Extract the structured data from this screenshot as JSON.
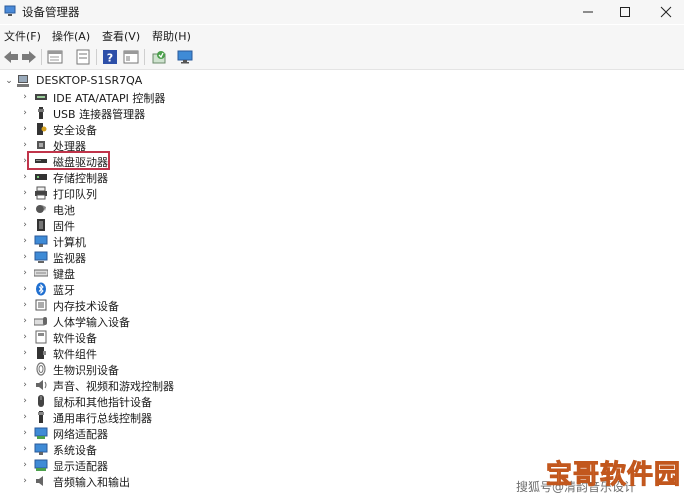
{
  "window": {
    "title": "设备管理器",
    "minimize_icon": "minimize-icon",
    "maximize_icon": "maximize-icon",
    "close_icon": "close-icon"
  },
  "menu": [
    {
      "label": "文件(F)"
    },
    {
      "label": "操作(A)"
    },
    {
      "label": "查看(V)"
    },
    {
      "label": "帮助(H)"
    }
  ],
  "toolbar": {
    "buttons": [
      "back-arrow-icon",
      "forward-arrow-icon",
      "properties-icon",
      "update-driver-icon",
      "help-icon",
      "view-icon",
      "scan-hardware-icon",
      "monitor-icon"
    ]
  },
  "tree": {
    "root": "DESKTOP-S1SR7QA",
    "nodes": [
      {
        "label": "IDE ATA/ATAPI 控制器",
        "icon": "ide-controller-icon"
      },
      {
        "label": "USB 连接器管理器",
        "icon": "usb-icon"
      },
      {
        "label": "安全设备",
        "icon": "security-device-icon"
      },
      {
        "label": "处理器",
        "icon": "processor-icon"
      },
      {
        "label": "磁盘驱动器",
        "icon": "disk-drive-icon"
      },
      {
        "label": "存储控制器",
        "icon": "storage-controller-icon"
      },
      {
        "label": "打印队列",
        "icon": "printer-icon"
      },
      {
        "label": "电池",
        "icon": "battery-icon"
      },
      {
        "label": "固件",
        "icon": "firmware-icon"
      },
      {
        "label": "计算机",
        "icon": "computer-icon"
      },
      {
        "label": "监视器",
        "icon": "monitor-icon"
      },
      {
        "label": "键盘",
        "icon": "keyboard-icon"
      },
      {
        "label": "蓝牙",
        "icon": "bluetooth-icon"
      },
      {
        "label": "内存技术设备",
        "icon": "memory-device-icon"
      },
      {
        "label": "人体学输入设备",
        "icon": "hid-icon"
      },
      {
        "label": "软件设备",
        "icon": "software-device-icon"
      },
      {
        "label": "软件组件",
        "icon": "software-component-icon"
      },
      {
        "label": "生物识别设备",
        "icon": "biometric-icon"
      },
      {
        "label": "声音、视频和游戏控制器",
        "icon": "sound-icon"
      },
      {
        "label": "鼠标和其他指针设备",
        "icon": "mouse-icon"
      },
      {
        "label": "通用串行总线控制器",
        "icon": "usb-controller-icon"
      },
      {
        "label": "网络适配器",
        "icon": "network-adapter-icon"
      },
      {
        "label": "系统设备",
        "icon": "system-device-icon"
      },
      {
        "label": "显示适配器",
        "icon": "display-adapter-icon"
      },
      {
        "label": "音频输入和输出",
        "icon": "audio-io-icon"
      }
    ]
  },
  "watermark": {
    "text": "搜狐号@清韵音乐设计",
    "logo_text": "宝哥软件园"
  },
  "colors": {
    "highlight": "#c0344a",
    "chrome": "#f6f6f6"
  }
}
